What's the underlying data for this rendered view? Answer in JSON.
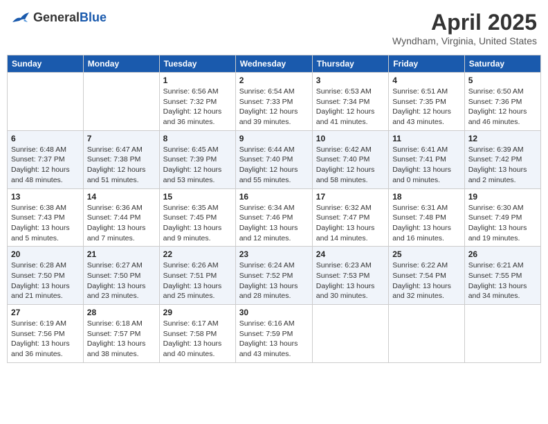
{
  "header": {
    "logo_general": "General",
    "logo_blue": "Blue",
    "month": "April 2025",
    "location": "Wyndham, Virginia, United States"
  },
  "weekdays": [
    "Sunday",
    "Monday",
    "Tuesday",
    "Wednesday",
    "Thursday",
    "Friday",
    "Saturday"
  ],
  "weeks": [
    [
      {
        "day": "",
        "info": ""
      },
      {
        "day": "",
        "info": ""
      },
      {
        "day": "1",
        "info": "Sunrise: 6:56 AM\nSunset: 7:32 PM\nDaylight: 12 hours and 36 minutes."
      },
      {
        "day": "2",
        "info": "Sunrise: 6:54 AM\nSunset: 7:33 PM\nDaylight: 12 hours and 39 minutes."
      },
      {
        "day": "3",
        "info": "Sunrise: 6:53 AM\nSunset: 7:34 PM\nDaylight: 12 hours and 41 minutes."
      },
      {
        "day": "4",
        "info": "Sunrise: 6:51 AM\nSunset: 7:35 PM\nDaylight: 12 hours and 43 minutes."
      },
      {
        "day": "5",
        "info": "Sunrise: 6:50 AM\nSunset: 7:36 PM\nDaylight: 12 hours and 46 minutes."
      }
    ],
    [
      {
        "day": "6",
        "info": "Sunrise: 6:48 AM\nSunset: 7:37 PM\nDaylight: 12 hours and 48 minutes."
      },
      {
        "day": "7",
        "info": "Sunrise: 6:47 AM\nSunset: 7:38 PM\nDaylight: 12 hours and 51 minutes."
      },
      {
        "day": "8",
        "info": "Sunrise: 6:45 AM\nSunset: 7:39 PM\nDaylight: 12 hours and 53 minutes."
      },
      {
        "day": "9",
        "info": "Sunrise: 6:44 AM\nSunset: 7:40 PM\nDaylight: 12 hours and 55 minutes."
      },
      {
        "day": "10",
        "info": "Sunrise: 6:42 AM\nSunset: 7:40 PM\nDaylight: 12 hours and 58 minutes."
      },
      {
        "day": "11",
        "info": "Sunrise: 6:41 AM\nSunset: 7:41 PM\nDaylight: 13 hours and 0 minutes."
      },
      {
        "day": "12",
        "info": "Sunrise: 6:39 AM\nSunset: 7:42 PM\nDaylight: 13 hours and 2 minutes."
      }
    ],
    [
      {
        "day": "13",
        "info": "Sunrise: 6:38 AM\nSunset: 7:43 PM\nDaylight: 13 hours and 5 minutes."
      },
      {
        "day": "14",
        "info": "Sunrise: 6:36 AM\nSunset: 7:44 PM\nDaylight: 13 hours and 7 minutes."
      },
      {
        "day": "15",
        "info": "Sunrise: 6:35 AM\nSunset: 7:45 PM\nDaylight: 13 hours and 9 minutes."
      },
      {
        "day": "16",
        "info": "Sunrise: 6:34 AM\nSunset: 7:46 PM\nDaylight: 13 hours and 12 minutes."
      },
      {
        "day": "17",
        "info": "Sunrise: 6:32 AM\nSunset: 7:47 PM\nDaylight: 13 hours and 14 minutes."
      },
      {
        "day": "18",
        "info": "Sunrise: 6:31 AM\nSunset: 7:48 PM\nDaylight: 13 hours and 16 minutes."
      },
      {
        "day": "19",
        "info": "Sunrise: 6:30 AM\nSunset: 7:49 PM\nDaylight: 13 hours and 19 minutes."
      }
    ],
    [
      {
        "day": "20",
        "info": "Sunrise: 6:28 AM\nSunset: 7:50 PM\nDaylight: 13 hours and 21 minutes."
      },
      {
        "day": "21",
        "info": "Sunrise: 6:27 AM\nSunset: 7:50 PM\nDaylight: 13 hours and 23 minutes."
      },
      {
        "day": "22",
        "info": "Sunrise: 6:26 AM\nSunset: 7:51 PM\nDaylight: 13 hours and 25 minutes."
      },
      {
        "day": "23",
        "info": "Sunrise: 6:24 AM\nSunset: 7:52 PM\nDaylight: 13 hours and 28 minutes."
      },
      {
        "day": "24",
        "info": "Sunrise: 6:23 AM\nSunset: 7:53 PM\nDaylight: 13 hours and 30 minutes."
      },
      {
        "day": "25",
        "info": "Sunrise: 6:22 AM\nSunset: 7:54 PM\nDaylight: 13 hours and 32 minutes."
      },
      {
        "day": "26",
        "info": "Sunrise: 6:21 AM\nSunset: 7:55 PM\nDaylight: 13 hours and 34 minutes."
      }
    ],
    [
      {
        "day": "27",
        "info": "Sunrise: 6:19 AM\nSunset: 7:56 PM\nDaylight: 13 hours and 36 minutes."
      },
      {
        "day": "28",
        "info": "Sunrise: 6:18 AM\nSunset: 7:57 PM\nDaylight: 13 hours and 38 minutes."
      },
      {
        "day": "29",
        "info": "Sunrise: 6:17 AM\nSunset: 7:58 PM\nDaylight: 13 hours and 40 minutes."
      },
      {
        "day": "30",
        "info": "Sunrise: 6:16 AM\nSunset: 7:59 PM\nDaylight: 13 hours and 43 minutes."
      },
      {
        "day": "",
        "info": ""
      },
      {
        "day": "",
        "info": ""
      },
      {
        "day": "",
        "info": ""
      }
    ]
  ]
}
